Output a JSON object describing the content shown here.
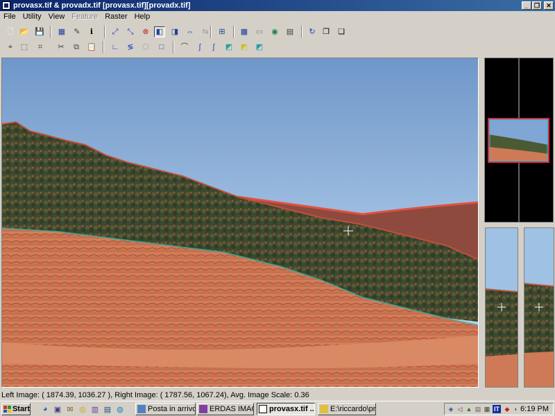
{
  "window": {
    "title": "provasx.tif & provadx.tif [provasx.tif][provadx.tif]",
    "minimize_glyph": "_",
    "restore_glyph": "❐",
    "close_glyph": "✕"
  },
  "menu": [
    "File",
    "Utility",
    "View",
    "Feature",
    "Raster",
    "Help"
  ],
  "menu_disabled": [
    "Feature"
  ],
  "toolbar1": [
    {
      "name": "new-file-icon",
      "glyph": "🗋",
      "color": "#ffffff"
    },
    {
      "name": "open-folder-icon",
      "glyph": "📂",
      "color": "#e0b020"
    },
    {
      "name": "save-icon",
      "glyph": "💾",
      "color": "#303080"
    },
    {
      "name": "layers-icon",
      "glyph": "▦",
      "color": "#2040a0"
    },
    {
      "name": "eraser-icon",
      "glyph": "✎",
      "color": "#404040"
    },
    {
      "name": "info-icon",
      "glyph": "ℹ",
      "color": "#000000"
    },
    {
      "name": "zoom-in-icon",
      "glyph": "⤢",
      "color": "#2040c0"
    },
    {
      "name": "zoom-out-icon",
      "glyph": "⤡",
      "color": "#2040c0"
    },
    {
      "name": "cancel-icon",
      "glyph": "⊗",
      "color": "#c02020"
    },
    {
      "name": "left-view-icon",
      "glyph": "◧",
      "color": "#2040a0"
    },
    {
      "name": "right-view-icon",
      "glyph": "◨",
      "color": "#2040a0"
    },
    {
      "name": "link-icon",
      "glyph": "⇔",
      "color": "#2040a0"
    },
    {
      "name": "swap-icon",
      "glyph": "⇆",
      "color": "#a0a0a0"
    },
    {
      "name": "fit-icon",
      "glyph": "⊞",
      "color": "#2040a0"
    },
    {
      "name": "overlay-icon",
      "glyph": "▩",
      "color": "#2040a0"
    },
    {
      "name": "ruler-icon",
      "glyph": "▭",
      "color": "#808080"
    },
    {
      "name": "globe-icon",
      "glyph": "◉",
      "color": "#208040"
    },
    {
      "name": "table-icon",
      "glyph": "▤",
      "color": "#404040"
    },
    {
      "name": "refresh-icon",
      "glyph": "↻",
      "color": "#2040c0"
    },
    {
      "name": "copy-window-icon",
      "glyph": "❐",
      "color": "#000000"
    },
    {
      "name": "paste-window-icon",
      "glyph": "❏",
      "color": "#000000"
    }
  ],
  "toolbar2": [
    {
      "name": "pointer-icon",
      "glyph": "⌖",
      "color": "#404040"
    },
    {
      "name": "select-box-icon",
      "glyph": "⬚",
      "color": "#404040"
    },
    {
      "name": "crop-icon",
      "glyph": "⌗",
      "color": "#404040"
    },
    {
      "name": "cut-icon",
      "glyph": "✂",
      "color": "#404040"
    },
    {
      "name": "copy-icon",
      "glyph": "⧉",
      "color": "#404040"
    },
    {
      "name": "paste-icon",
      "glyph": "📋",
      "color": "#c0a020"
    },
    {
      "name": "angle-icon",
      "glyph": "∟",
      "color": "#2040c0"
    },
    {
      "name": "polyline-icon",
      "glyph": "≶",
      "color": "#2040c0"
    },
    {
      "name": "polygon-icon",
      "glyph": "⬠",
      "color": "#a0a0a0"
    },
    {
      "name": "rectangle-icon",
      "glyph": "□",
      "color": "#2040c0"
    },
    {
      "name": "curve-icon",
      "glyph": "⌒",
      "color": "#404040"
    },
    {
      "name": "stream-icon",
      "glyph": "ʃ",
      "color": "#2040c0"
    },
    {
      "name": "stream-alt-icon",
      "glyph": "ʃ",
      "color": "#2040c0"
    },
    {
      "name": "cube-teal-icon",
      "glyph": "◩",
      "color": "#20a0a0"
    },
    {
      "name": "cube-yellow-icon",
      "glyph": "◩",
      "color": "#d0c020"
    },
    {
      "name": "cube-cyan-icon",
      "glyph": "◩",
      "color": "#20a0a0"
    }
  ],
  "status": "Left Image: ( 1874.39, 1036.27 ), Right Image: ( 1787.56, 1067.24), Avg. Image Scale: 0.36",
  "taskbar": {
    "start_label": "Start",
    "tasks": [
      {
        "label": "Posta in arrivo ...",
        "active": false
      },
      {
        "label": "ERDAS IMAGI...",
        "active": false
      },
      {
        "label": "provasx.tif ...",
        "active": true
      },
      {
        "label": "E:\\riccardo\\pro...",
        "active": false
      }
    ],
    "language": "IT",
    "clock": "6:19 PM"
  },
  "colors": {
    "title_start": "#0a246a",
    "title_end": "#3a6ea5",
    "face": "#d4d0c8"
  }
}
